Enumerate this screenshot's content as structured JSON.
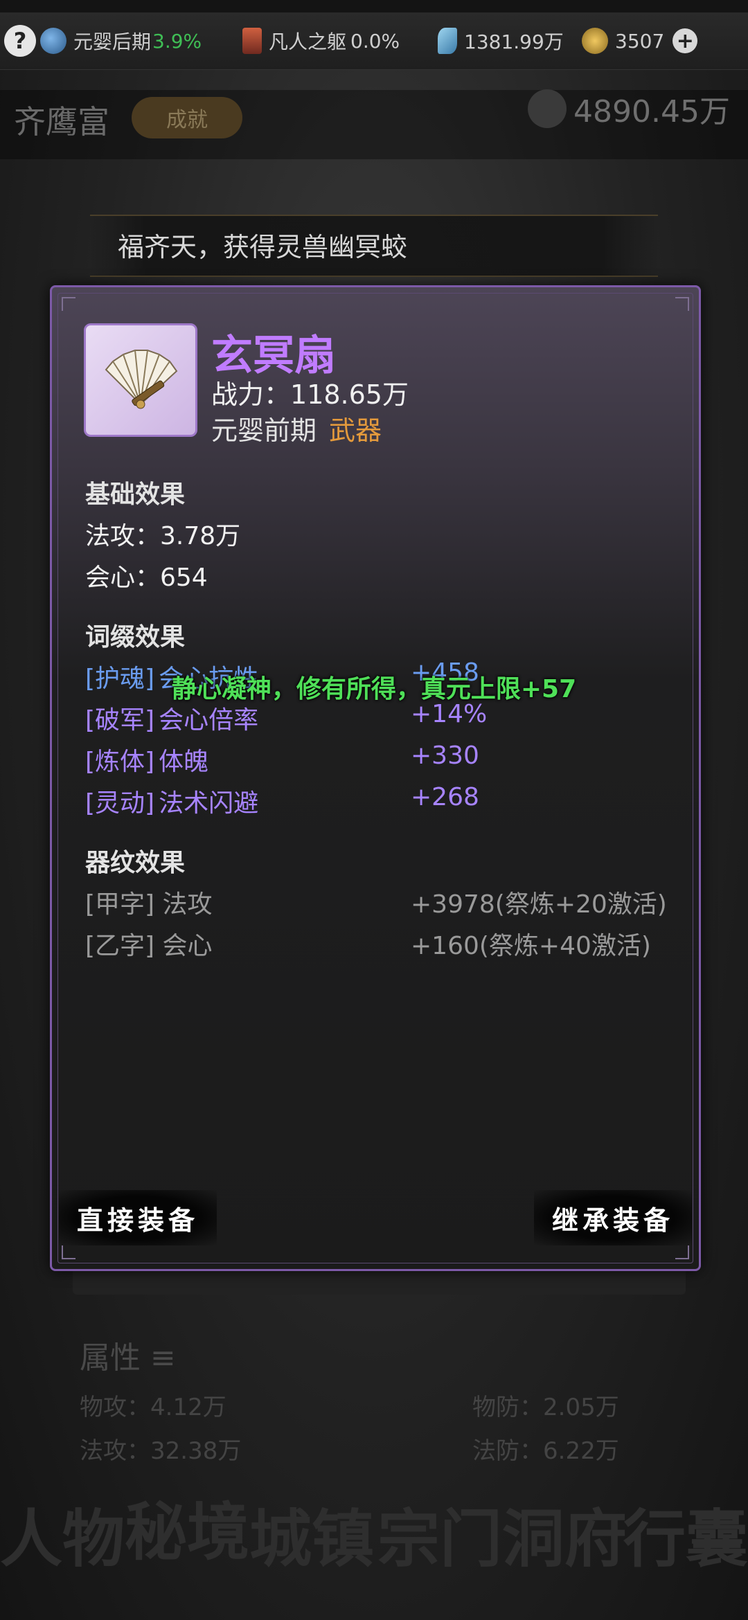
{
  "topbar": {
    "realm_label": "元婴后期",
    "realm_progress": "3.9%",
    "body_label": "凡人之躯",
    "body_progress": "0.0%",
    "spirit_stones": "1381.99万",
    "gold": "3507",
    "help_icon": "?",
    "plus_icon": "+"
  },
  "background": {
    "player_name": "齐鹰富",
    "achievement_label": "成就",
    "currency": "4890.45万",
    "marquee": "福齐天，获得灵兽幽冥蛟",
    "attr_title": "属性",
    "attrs": [
      {
        "label": "物攻：4.12万"
      },
      {
        "label": "物防：2.05万"
      },
      {
        "label": "法攻：32.38万"
      },
      {
        "label": "法防：6.22万"
      }
    ],
    "nav": [
      "人物",
      "秘境",
      "城镇",
      "宗门",
      "洞府",
      "行囊"
    ]
  },
  "toast": "静心凝神，修有所得，真元上限+57",
  "item": {
    "name": "玄冥扇",
    "power_label": "战力：",
    "power_value": "118.65万",
    "realm": "元婴前期",
    "type": "武器",
    "icon": "fan-icon"
  },
  "base_effects": {
    "title": "基础效果",
    "stats": [
      {
        "label": "法攻：3.78万"
      },
      {
        "label": "会心：654"
      }
    ]
  },
  "affix_effects": {
    "title": "词缀效果",
    "rows": [
      {
        "tag": "[护魂]",
        "name": "会心抗性",
        "value": "+458"
      },
      {
        "tag": "[破军]",
        "name": "会心倍率",
        "value": "+14%"
      },
      {
        "tag": "[炼体]",
        "name": "体魄",
        "value": "+330"
      },
      {
        "tag": "[灵动]",
        "name": "法术闪避",
        "value": "+268"
      }
    ]
  },
  "rune_effects": {
    "title": "器纹效果",
    "rows": [
      {
        "tag": "[甲字]",
        "name": "法攻",
        "value": "+3978(祭炼+20激活)"
      },
      {
        "tag": "[乙字]",
        "name": "会心",
        "value": "+160(祭炼+40激活)"
      }
    ]
  },
  "buttons": {
    "equip": "直接装备",
    "inherit": "继承装备"
  },
  "colors": {
    "item_name": "#c07cff",
    "item_type": "#e49a3c",
    "affix": "#a784ff",
    "affix_first": "#6a9cf0",
    "toast": "#4fe058",
    "dialog_border": "#7d5aa8"
  }
}
